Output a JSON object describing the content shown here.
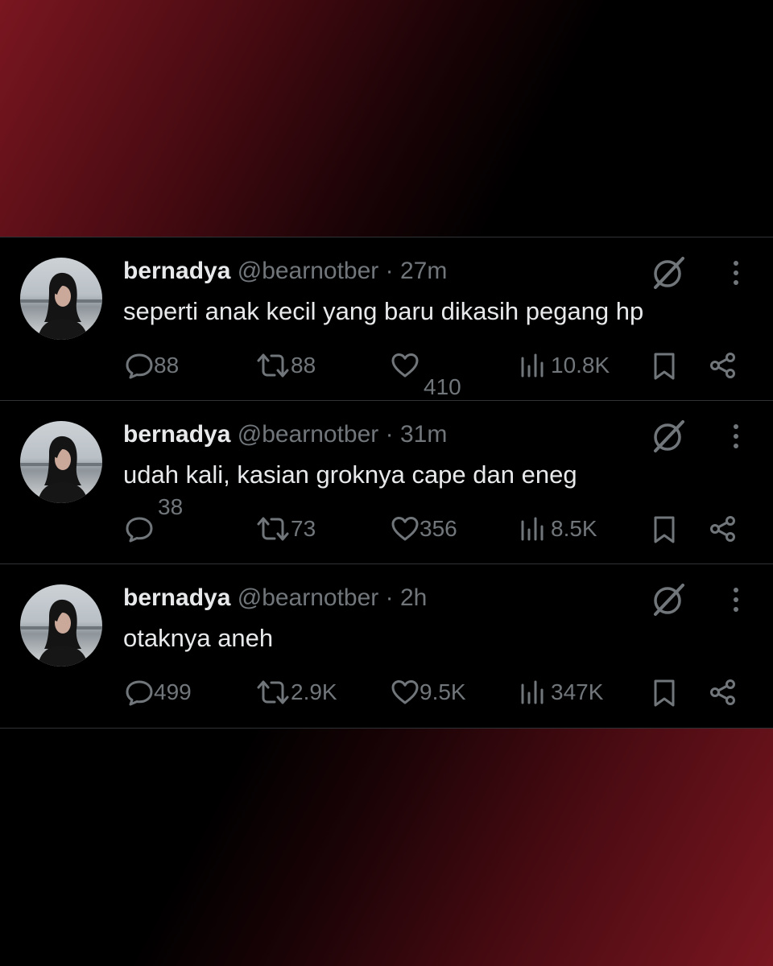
{
  "tweets": [
    {
      "name": "bernadya",
      "handle": "@bearnotber",
      "separator": "·",
      "time": "27m",
      "text": "seperti anak kecil yang baru dikasih pegang hp",
      "replies": "88",
      "retweets": "88",
      "likes": "410",
      "views": "10.8K"
    },
    {
      "name": "bernadya",
      "handle": "@bearnotber",
      "separator": "·",
      "time": "31m",
      "text": "udah kali, kasian groknya cape dan eneg",
      "replies": "38",
      "retweets": "73",
      "likes": "356",
      "views": "8.5K"
    },
    {
      "name": "bernadya",
      "handle": "@bearnotber",
      "separator": "·",
      "time": "2h",
      "text": "otaknya aneh",
      "replies": "499",
      "retweets": "2.9K",
      "likes": "9.5K",
      "views": "347K"
    }
  ],
  "icons": {
    "reply": "reply-icon",
    "retweet": "retweet-icon",
    "like": "heart-icon",
    "views": "views-icon",
    "bookmark": "bookmark-icon",
    "share": "share-icon",
    "grok": "grok-icon",
    "more": "more-icon"
  },
  "colors": {
    "text_primary": "#e7e9ea",
    "text_secondary": "#71767b",
    "background": "#000000",
    "accent_gradient": "#7a1620"
  }
}
